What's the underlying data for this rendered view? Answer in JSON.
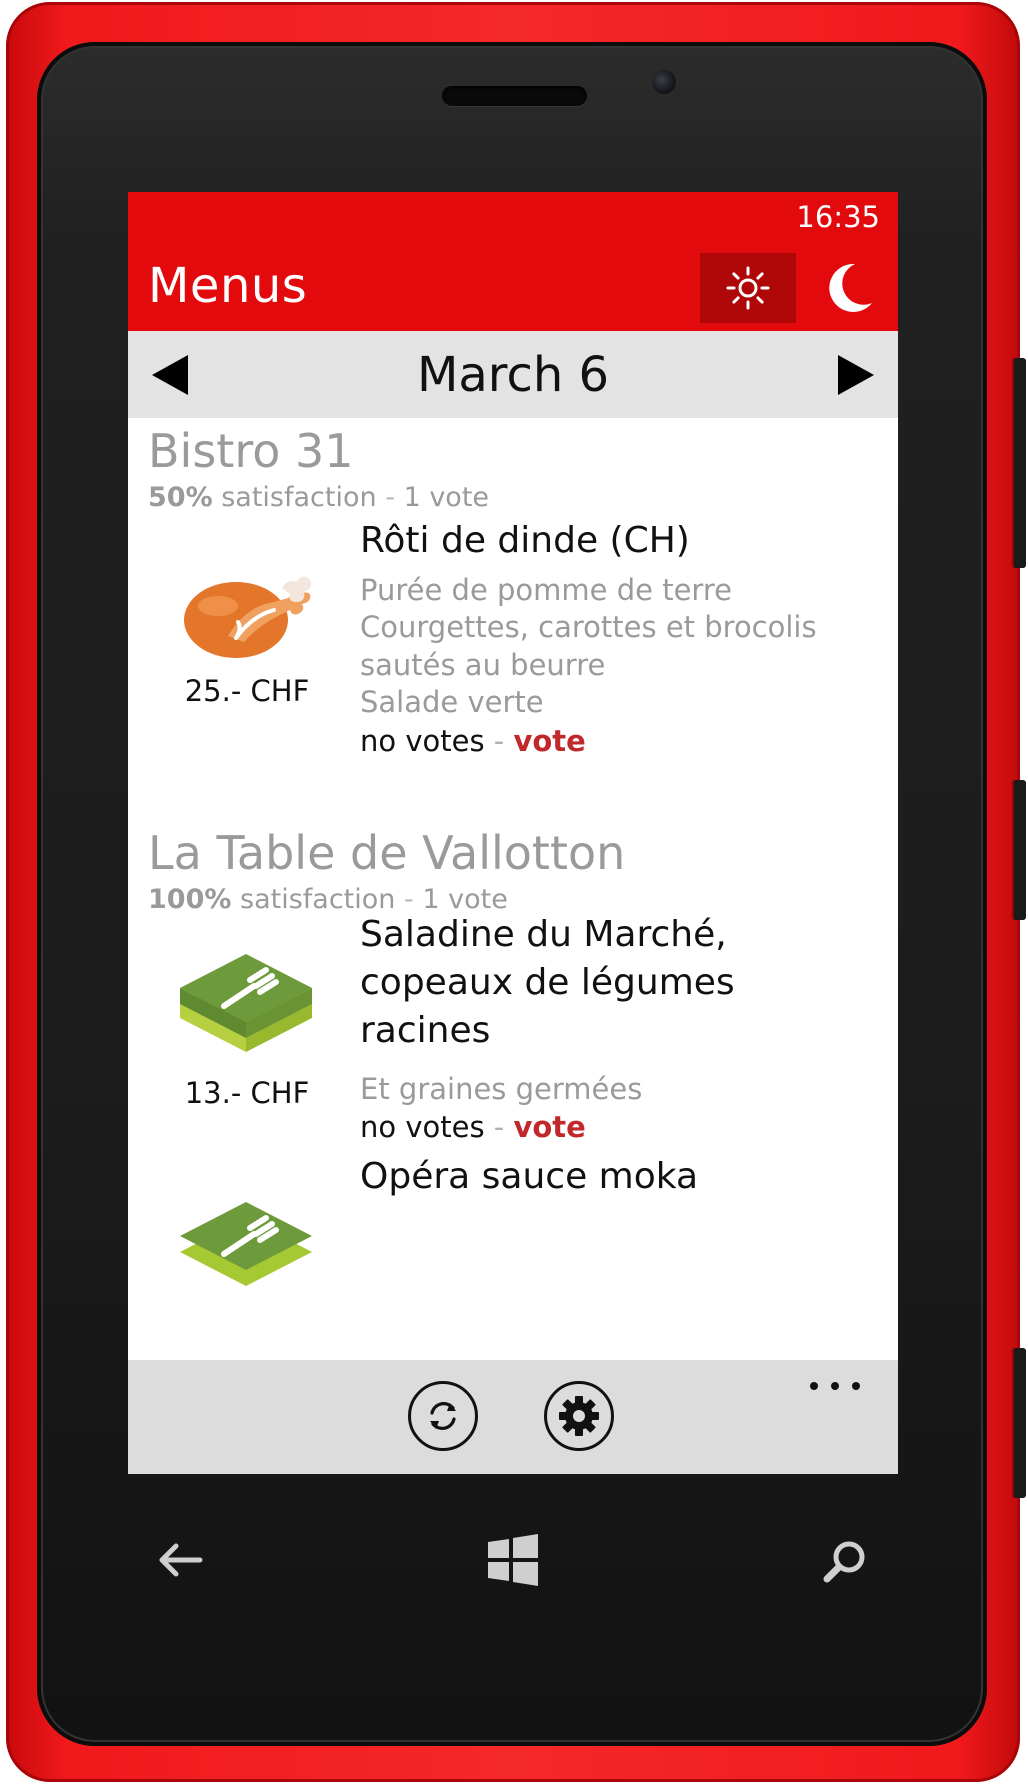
{
  "status_bar": {
    "time": "16:35"
  },
  "header": {
    "title": "Menus",
    "light_theme_icon": "sun-icon",
    "dark_theme_icon": "moon-icon"
  },
  "date_nav": {
    "date": "March 6",
    "prev_icon": "triangle-left-icon",
    "next_icon": "triangle-right-icon"
  },
  "restaurants": [
    {
      "name": "Bistro 31",
      "satisfaction_percent": "50%",
      "satisfaction_text": "satisfaction",
      "separator": "-",
      "votes": "1 vote",
      "dishes": [
        {
          "icon": "roast-chicken-icon",
          "price": "25.- CHF",
          "title": "Rôti de dinde (CH)",
          "details": [
            "Purée de pomme de terre",
            "Courgettes, carottes et brocolis",
            "sautés au beurre",
            "Salade verte"
          ],
          "vote_status": "no votes",
          "separator": "-",
          "vote_label": "vote"
        }
      ]
    },
    {
      "name": "La Table de Vallotton",
      "satisfaction_percent": "100%",
      "satisfaction_text": "satisfaction",
      "separator": "-",
      "votes": "1 vote",
      "dishes": [
        {
          "icon": "green-fork-tile-icon",
          "price": "13.- CHF",
          "title_lines": [
            "Saladine du Marché,",
            "copeaux de légumes",
            "racines"
          ],
          "details": [
            "Et graines germées"
          ],
          "vote_status": "no votes",
          "separator": "-",
          "vote_label": "vote"
        },
        {
          "icon": "green-fork-tile-icon",
          "title": "Opéra sauce moka"
        }
      ]
    }
  ],
  "app_bar": {
    "refresh_icon": "refresh-icon",
    "settings_icon": "gear-icon",
    "more_icon": "more-dots-icon"
  },
  "hardware_keys": [
    "back-arrow-icon",
    "windows-logo-icon",
    "search-icon"
  ],
  "colors": {
    "accent": "#e20a0d",
    "accent_dark": "#b00708",
    "vote_link": "#c0282c",
    "muted_text": "#9a9a9a",
    "date_bar": "#e3e3e3",
    "app_bar": "#dcdcdc",
    "dish_tile_green": "#6d9a3a",
    "chicken_orange": "#e4762b"
  }
}
